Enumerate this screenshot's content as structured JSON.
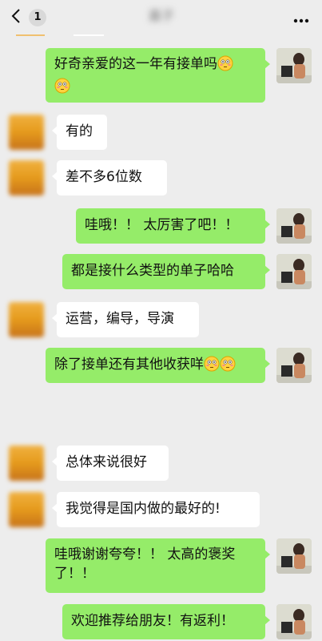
{
  "header": {
    "unread_count": "1",
    "title": "嘉子"
  },
  "messages": [
    {
      "side": "out",
      "text": "好奇亲爱的这一年有接单吗",
      "emoji": "😳😳"
    },
    {
      "side": "in",
      "text": "有的"
    },
    {
      "side": "in",
      "text": "差不多6位数"
    },
    {
      "side": "out",
      "text": "哇哦！！ 太厉害了吧！！"
    },
    {
      "side": "out",
      "text": "都是接什么类型的单子哈哈"
    },
    {
      "side": "in",
      "text": "运营，编导，导演"
    },
    {
      "side": "out",
      "text": "除了接单还有其他收获咩",
      "emoji": "😳😳"
    },
    {
      "side": "in",
      "text": "总体来说很好"
    },
    {
      "side": "in",
      "text": "我觉得是国内做的最好的!"
    },
    {
      "side": "out",
      "text_line1": "哇哦谢谢夸夸！！ 太高的褒奖",
      "text_line2": "了！！"
    },
    {
      "side": "out",
      "text": "欢迎推荐给朋友！有返利！"
    }
  ],
  "colors": {
    "outgoing_bubble": "#95ec69",
    "incoming_bubble": "#ffffff",
    "background": "#ededed"
  },
  "icons": [
    "back-arrow-icon",
    "more-dots-icon",
    "flushed-face-emoji"
  ]
}
